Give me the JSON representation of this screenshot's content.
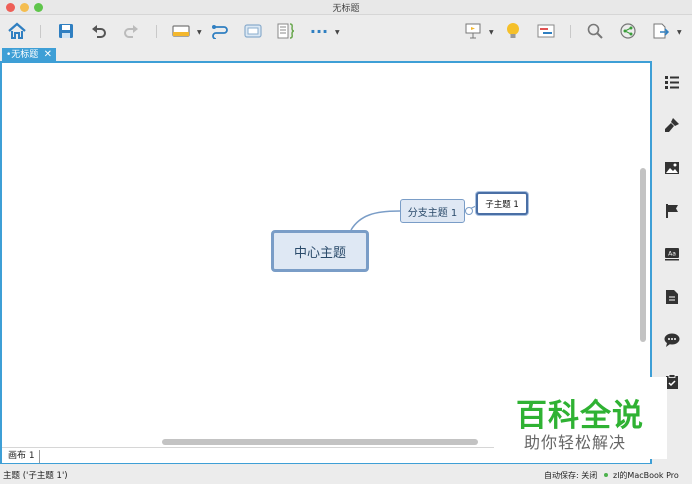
{
  "window": {
    "title": "无标题"
  },
  "toolbar": {
    "icons": [
      "home-icon",
      "save-icon",
      "undo-icon",
      "redo-icon",
      "insert-topic-icon",
      "relationship-icon",
      "boundary-icon",
      "summary-icon",
      "more-icon",
      "presentation-icon",
      "idea-icon",
      "gantt-icon",
      "search-icon",
      "share-icon",
      "export-icon"
    ],
    "more_label": "···"
  },
  "tab": {
    "label": "•无标题",
    "close": "✕"
  },
  "mindmap": {
    "central": "中心主题",
    "branch": "分支主题 1",
    "subtopic": "子主题 1"
  },
  "sheet": {
    "label": "画布 1"
  },
  "status": {
    "selection": "主题 ('子主题 1')",
    "autosave": "自动保存: 关闭",
    "device": "zl的MacBook Pro"
  },
  "sidebar": {
    "icons": [
      "outline-icon",
      "format-brush-icon",
      "image-icon",
      "marker-flag-icon",
      "text-style-icon",
      "notes-icon",
      "comment-icon",
      "task-icon"
    ]
  },
  "watermark": {
    "title": "百科全说",
    "subtitle": "助你轻松解决"
  },
  "colors": {
    "accent": "#3e9fd6",
    "node_fill": "#dfe8f4",
    "node_border": "#7a9dc7",
    "watermark_green": "#2fb233"
  }
}
